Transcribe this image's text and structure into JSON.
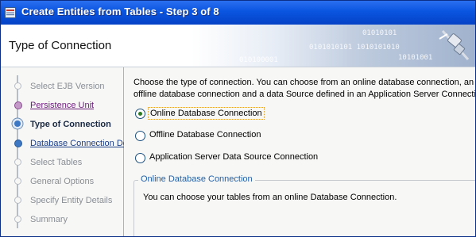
{
  "window": {
    "title": "Create Entities from Tables - Step 3 of 8"
  },
  "header": {
    "title": "Type of Connection",
    "art_binary": [
      "01010101",
      "0101010101 1010101010",
      "10101001",
      "010100001"
    ]
  },
  "steps": [
    {
      "label": "Select EJB Version",
      "state": "done"
    },
    {
      "label": "Persistence Unit",
      "state": "link"
    },
    {
      "label": "Type of Connection",
      "state": "current"
    },
    {
      "label": "Database Connection Details",
      "state": "link"
    },
    {
      "label": "Select Tables",
      "state": "pending"
    },
    {
      "label": "General Options",
      "state": "pending"
    },
    {
      "label": "Specify Entity Details",
      "state": "pending"
    },
    {
      "label": "Summary",
      "state": "pending"
    }
  ],
  "main": {
    "description_line1": "Choose the type of connection. You can choose from an online database connection, an",
    "description_line2": "offline database connection and a data Source defined in an Application Server Connection.",
    "options": [
      {
        "label": "Online Database Connection",
        "checked": true
      },
      {
        "label": "Offline Database Connection",
        "checked": false
      },
      {
        "label": "Application Server Data Source Connection",
        "checked": false
      }
    ],
    "group_title": "Online Database Connection",
    "group_text": "You can choose your tables from an online Database Connection."
  },
  "colors": {
    "titlebar": "#0a55e0",
    "link": "#6a1b7a",
    "group_title": "#2160a8"
  }
}
